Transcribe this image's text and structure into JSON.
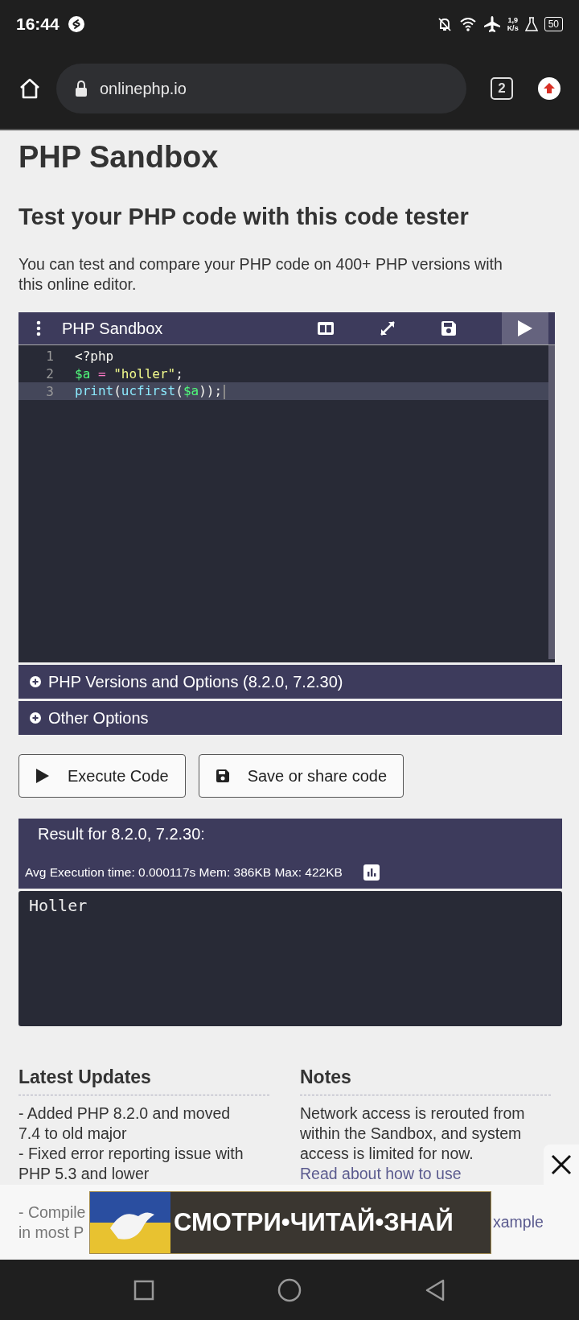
{
  "status_bar": {
    "time": "16:44",
    "network_speed": "1,9",
    "network_unit": "K/s",
    "battery": "50"
  },
  "browser": {
    "url": "onlinephp.io",
    "tab_count": "2"
  },
  "page": {
    "title": "PHP Sandbox",
    "subtitle": "Test your PHP code with this code tester",
    "intro": "You can test and compare your PHP code on 400+ PHP versions with this online editor."
  },
  "editor": {
    "title": "PHP Sandbox",
    "lines": [
      {
        "number": "1",
        "active": false,
        "tokens": [
          {
            "text": "<?php",
            "kind": "plain"
          }
        ]
      },
      {
        "number": "2",
        "active": false,
        "tokens": [
          {
            "text": "$a",
            "kind": "variable"
          },
          {
            "text": " = ",
            "kind": "operator"
          },
          {
            "text": "\"holler\"",
            "kind": "string"
          },
          {
            "text": ";",
            "kind": "plain"
          }
        ]
      },
      {
        "number": "3",
        "active": true,
        "tokens": [
          {
            "text": "print",
            "kind": "function"
          },
          {
            "text": "(",
            "kind": "plain"
          },
          {
            "text": "ucfirst",
            "kind": "function"
          },
          {
            "text": "(",
            "kind": "plain"
          },
          {
            "text": "$a",
            "kind": "variable"
          },
          {
            "text": "));",
            "kind": "plain"
          }
        ]
      }
    ]
  },
  "panels": [
    {
      "label": "PHP Versions and Options (8.2.0, 7.2.30)",
      "expanded": false
    },
    {
      "label": "Other Options",
      "expanded": false
    }
  ],
  "buttons": [
    {
      "label": "Execute Code",
      "kind": "play"
    },
    {
      "label": "Save or share code",
      "kind": "save"
    }
  ],
  "result": {
    "title": "Result for 8.2.0, 7.2.30:",
    "stats": "Avg Execution time: 0.000117s Mem: 386KB Max: 422KB",
    "output": "Holler"
  },
  "updates": {
    "title": "Latest Updates",
    "items": [
      "- Added PHP 8.2.0 and moved 7.4 to old major",
      "- Fixed error reporting issue with PHP 5.3 and lower"
    ],
    "partial_lines": [
      "- Compile",
      "in most P"
    ]
  },
  "notes": {
    "title": "Notes",
    "text": "Network access is rerouted from within the Sandbox, and system access is limited for now. ",
    "link": "Read about how to use",
    "partial_link": "xample"
  },
  "ad": {
    "text": "СМОТРИ•ЧИТАЙ•ЗНАЙ"
  }
}
